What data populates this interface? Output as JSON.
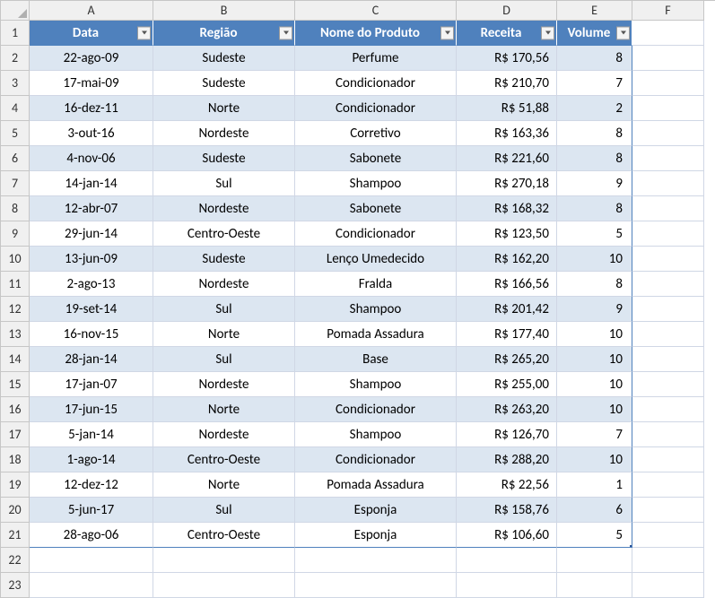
{
  "columns": [
    "A",
    "B",
    "C",
    "D",
    "E",
    "F"
  ],
  "headers": [
    "Data",
    "Região",
    "Nome do Produto",
    "Receita",
    "Volume"
  ],
  "rows": [
    {
      "n": 1
    },
    {
      "n": 2,
      "data": "22-ago-09",
      "regiao": "Sudeste",
      "produto": "Perfume",
      "receita": "R$ 170,56",
      "volume": "8"
    },
    {
      "n": 3,
      "data": "17-mai-09",
      "regiao": "Sudeste",
      "produto": "Condicionador",
      "receita": "R$ 210,70",
      "volume": "7"
    },
    {
      "n": 4,
      "data": "16-dez-11",
      "regiao": "Norte",
      "produto": "Condicionador",
      "receita": "R$ 51,88",
      "volume": "2"
    },
    {
      "n": 5,
      "data": "3-out-16",
      "regiao": "Nordeste",
      "produto": "Corretivo",
      "receita": "R$ 163,36",
      "volume": "8"
    },
    {
      "n": 6,
      "data": "4-nov-06",
      "regiao": "Sudeste",
      "produto": "Sabonete",
      "receita": "R$ 221,60",
      "volume": "8"
    },
    {
      "n": 7,
      "data": "14-jan-14",
      "regiao": "Sul",
      "produto": "Shampoo",
      "receita": "R$ 270,18",
      "volume": "9"
    },
    {
      "n": 8,
      "data": "12-abr-07",
      "regiao": "Nordeste",
      "produto": "Sabonete",
      "receita": "R$ 168,32",
      "volume": "8"
    },
    {
      "n": 9,
      "data": "29-jun-14",
      "regiao": "Centro-Oeste",
      "produto": "Condicionador",
      "receita": "R$ 123,50",
      "volume": "5"
    },
    {
      "n": 10,
      "data": "13-jun-09",
      "regiao": "Sudeste",
      "produto": "Lenço Umedecido",
      "receita": "R$ 162,20",
      "volume": "10"
    },
    {
      "n": 11,
      "data": "2-ago-13",
      "regiao": "Nordeste",
      "produto": "Fralda",
      "receita": "R$ 166,56",
      "volume": "8"
    },
    {
      "n": 12,
      "data": "19-set-14",
      "regiao": "Sul",
      "produto": "Shampoo",
      "receita": "R$ 201,42",
      "volume": "9"
    },
    {
      "n": 13,
      "data": "16-nov-15",
      "regiao": "Norte",
      "produto": "Pomada Assadura",
      "receita": "R$ 177,40",
      "volume": "10"
    },
    {
      "n": 14,
      "data": "28-jan-14",
      "regiao": "Sul",
      "produto": "Base",
      "receita": "R$ 265,20",
      "volume": "10"
    },
    {
      "n": 15,
      "data": "17-jan-07",
      "regiao": "Nordeste",
      "produto": "Shampoo",
      "receita": "R$ 255,00",
      "volume": "10"
    },
    {
      "n": 16,
      "data": "17-jun-15",
      "regiao": "Norte",
      "produto": "Condicionador",
      "receita": "R$ 263,20",
      "volume": "10"
    },
    {
      "n": 17,
      "data": "5-jan-14",
      "regiao": "Nordeste",
      "produto": "Shampoo",
      "receita": "R$ 126,70",
      "volume": "7"
    },
    {
      "n": 18,
      "data": "1-ago-14",
      "regiao": "Centro-Oeste",
      "produto": "Condicionador",
      "receita": "R$ 288,20",
      "volume": "10"
    },
    {
      "n": 19,
      "data": "12-dez-12",
      "regiao": "Norte",
      "produto": "Pomada Assadura",
      "receita": "R$ 22,56",
      "volume": "1"
    },
    {
      "n": 20,
      "data": "5-jun-17",
      "regiao": "Sul",
      "produto": "Esponja",
      "receita": "R$ 158,76",
      "volume": "6"
    },
    {
      "n": 21,
      "data": "28-ago-06",
      "regiao": "Centro-Oeste",
      "produto": "Esponja",
      "receita": "R$ 106,60",
      "volume": "5"
    },
    {
      "n": 22
    },
    {
      "n": 23
    }
  ],
  "chart_data": {
    "type": "table",
    "title": "",
    "columns": [
      "Data",
      "Região",
      "Nome do Produto",
      "Receita",
      "Volume"
    ],
    "records": [
      [
        "22-ago-09",
        "Sudeste",
        "Perfume",
        170.56,
        8
      ],
      [
        "17-mai-09",
        "Sudeste",
        "Condicionador",
        210.7,
        7
      ],
      [
        "16-dez-11",
        "Norte",
        "Condicionador",
        51.88,
        2
      ],
      [
        "3-out-16",
        "Nordeste",
        "Corretivo",
        163.36,
        8
      ],
      [
        "4-nov-06",
        "Sudeste",
        "Sabonete",
        221.6,
        8
      ],
      [
        "14-jan-14",
        "Sul",
        "Shampoo",
        270.18,
        9
      ],
      [
        "12-abr-07",
        "Nordeste",
        "Sabonete",
        168.32,
        8
      ],
      [
        "29-jun-14",
        "Centro-Oeste",
        "Condicionador",
        123.5,
        5
      ],
      [
        "13-jun-09",
        "Sudeste",
        "Lenço Umedecido",
        162.2,
        10
      ],
      [
        "2-ago-13",
        "Nordeste",
        "Fralda",
        166.56,
        8
      ],
      [
        "19-set-14",
        "Sul",
        "Shampoo",
        201.42,
        9
      ],
      [
        "16-nov-15",
        "Norte",
        "Pomada Assadura",
        177.4,
        10
      ],
      [
        "28-jan-14",
        "Sul",
        "Base",
        265.2,
        10
      ],
      [
        "17-jan-07",
        "Nordeste",
        "Shampoo",
        255.0,
        10
      ],
      [
        "17-jun-15",
        "Norte",
        "Condicionador",
        263.2,
        10
      ],
      [
        "5-jan-14",
        "Nordeste",
        "Shampoo",
        126.7,
        7
      ],
      [
        "1-ago-14",
        "Centro-Oeste",
        "Condicionador",
        288.2,
        10
      ],
      [
        "12-dez-12",
        "Norte",
        "Pomada Assadura",
        22.56,
        1
      ],
      [
        "5-jun-17",
        "Sul",
        "Esponja",
        158.76,
        6
      ],
      [
        "28-ago-06",
        "Centro-Oeste",
        "Esponja",
        106.6,
        5
      ]
    ]
  }
}
